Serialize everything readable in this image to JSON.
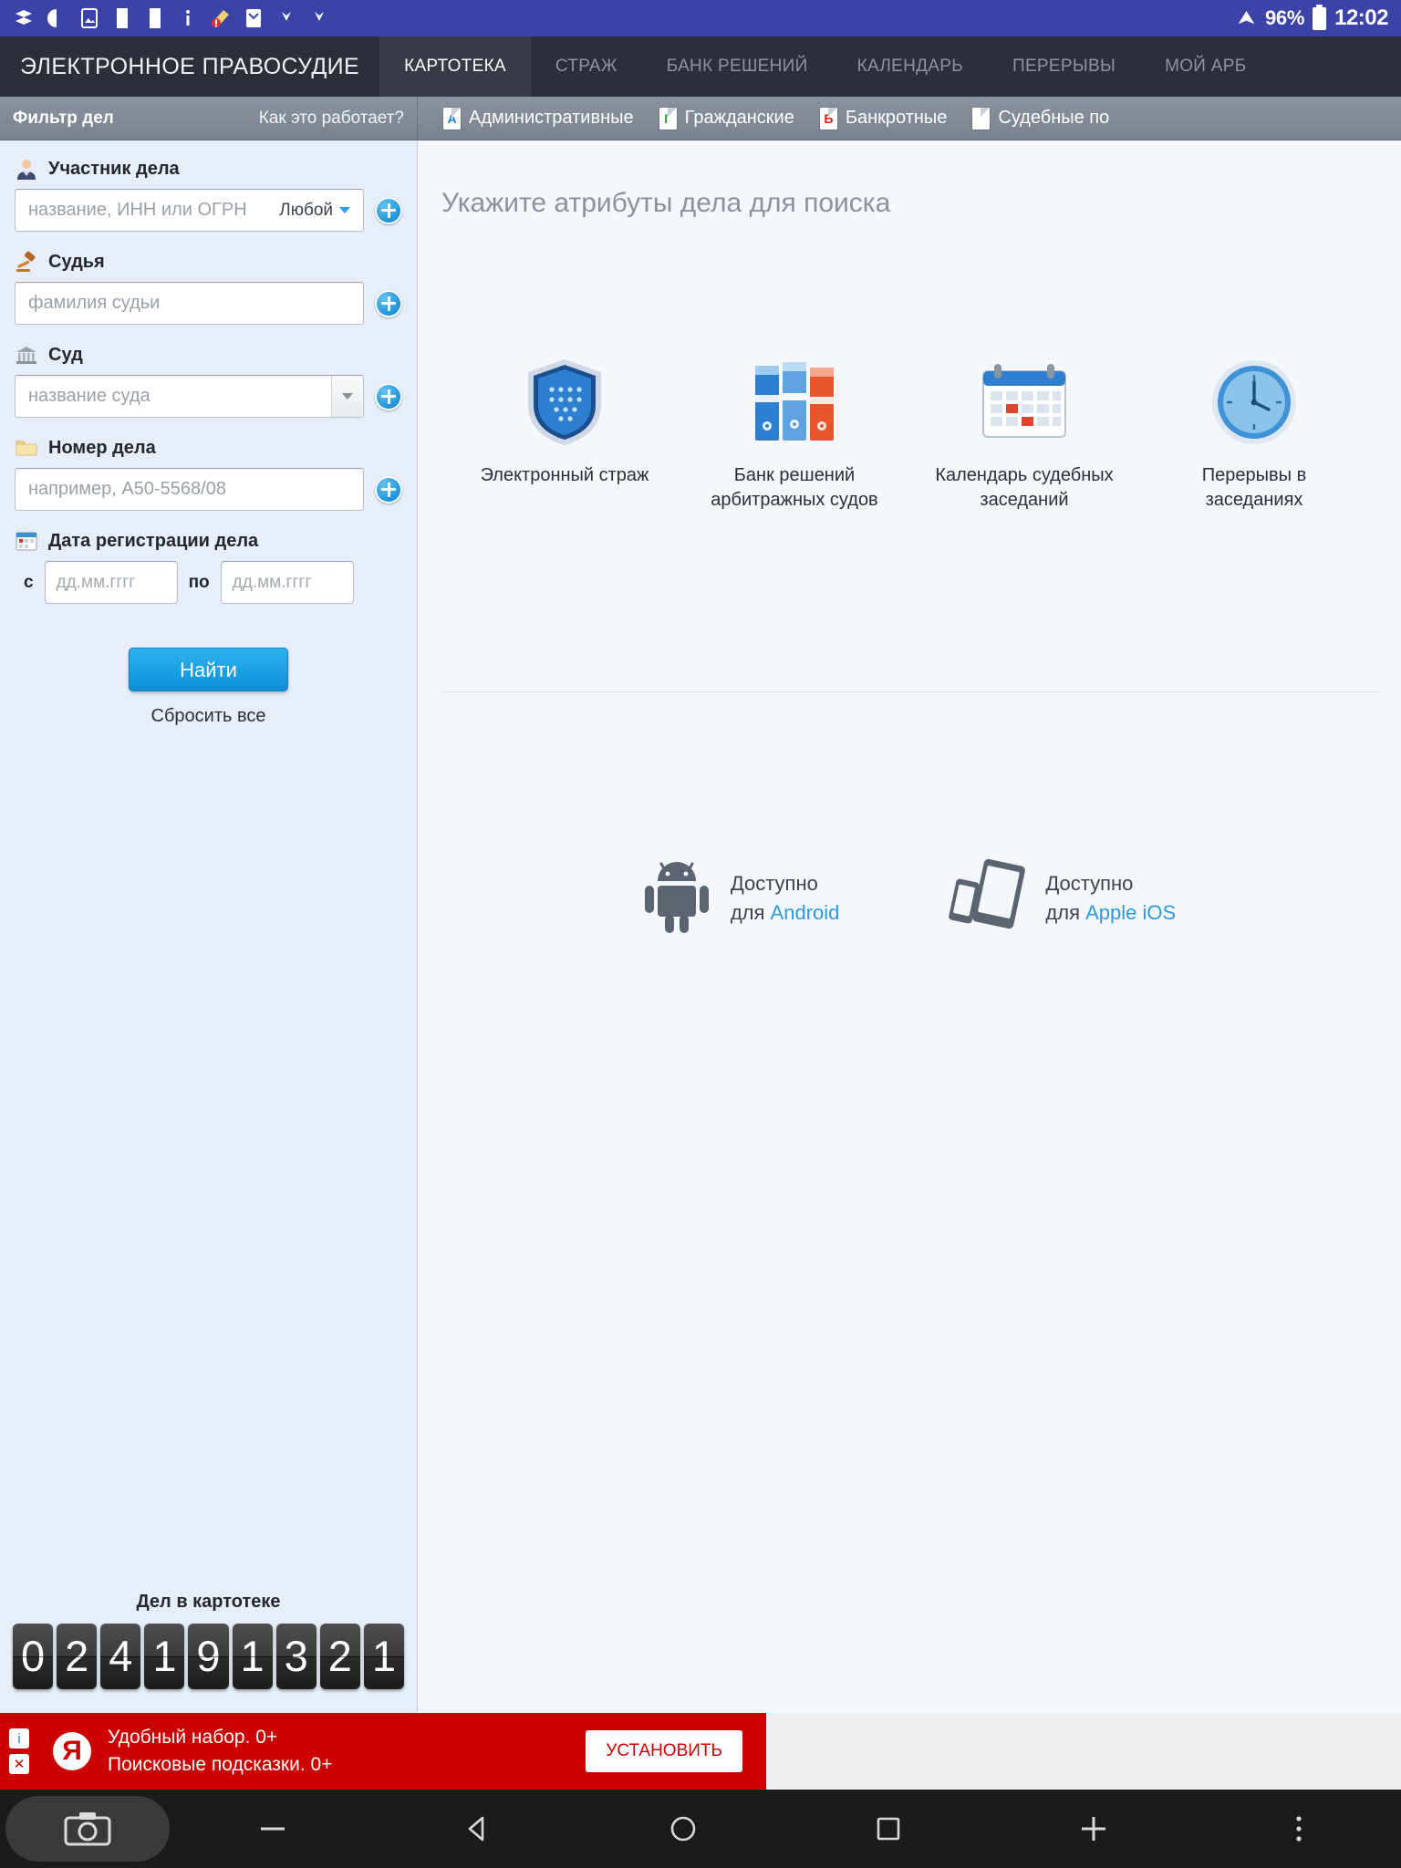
{
  "status_bar": {
    "icons": [
      "stack-icon",
      "navigation-arrow-icon",
      "photo-icon",
      "blank-doc-icon",
      "blank-doc2-icon",
      "info-icon",
      "cleanup-alert-icon",
      "gmail-icon",
      "chevron-down-icon",
      "chevron-down2-icon"
    ],
    "wifi_icon": "wifi-icon",
    "battery_percent": "96%",
    "battery_icon": "battery-icon",
    "time": "12:02"
  },
  "header": {
    "brand": "ЭЛЕКТРОННОЕ ПРАВОСУДИЕ",
    "tabs": [
      {
        "label": "КАРТОТЕКА",
        "active": true
      },
      {
        "label": "СТРАЖ",
        "active": false
      },
      {
        "label": "БАНК РЕШЕНИЙ",
        "active": false
      },
      {
        "label": "КАЛЕНДАРЬ",
        "active": false
      },
      {
        "label": "ПЕРЕРЫВЫ",
        "active": false
      },
      {
        "label": "МОЙ АРБ",
        "active": false
      }
    ]
  },
  "subbar": {
    "filter_title": "Фильтр дел",
    "help_link": "Как это работает?",
    "categories": [
      {
        "label": "Административные",
        "letter": "А",
        "color": "#1f7fd0"
      },
      {
        "label": "Гражданские",
        "letter": "Г",
        "color": "#2aa63c"
      },
      {
        "label": "Банкротные",
        "letter": "Б",
        "color": "#cc2222"
      },
      {
        "label": "Судебные по",
        "letter": "",
        "color": "#9aa3ad"
      }
    ]
  },
  "sidebar": {
    "fields": [
      {
        "id": "participant",
        "icon": "person-icon",
        "label": "Участник дела",
        "placeholder": "название, ИНН или ОГРН",
        "value": "",
        "select_value": "Любой",
        "has_add": true
      },
      {
        "id": "judge",
        "icon": "gavel-icon",
        "label": "Судья",
        "placeholder": "фамилия судьи",
        "value": "",
        "has_add": true
      },
      {
        "id": "court",
        "icon": "courthouse-icon",
        "label": "Суд",
        "placeholder": "название суда",
        "value": "",
        "has_dropdown": true,
        "has_add": true
      },
      {
        "id": "case-number",
        "icon": "folder-icon",
        "label": "Номер дела",
        "placeholder": "например, А50-5568/08",
        "value": "",
        "has_add": true
      }
    ],
    "date_section": {
      "icon": "calendar-icon",
      "label": "Дата регистрации дела",
      "from_label": "с",
      "from_placeholder": "дд.мм.гггг",
      "from_value": "",
      "to_label": "по",
      "to_placeholder": "дд.мм.гггг",
      "to_value": ""
    },
    "search_button": "Найти",
    "reset_link": "Сбросить все",
    "counter": {
      "title": "Дел в картотеке",
      "digits": [
        "0",
        "2",
        "4",
        "1",
        "9",
        "1",
        "3",
        "2",
        "1"
      ]
    }
  },
  "main": {
    "title": "Укажите атрибуты дела для поиска",
    "promos": [
      {
        "icon": "shield-icon",
        "label": "Электронный страж"
      },
      {
        "icon": "binders-icon",
        "label": "Банк решений арбитражных судов"
      },
      {
        "icon": "calendar-big-icon",
        "label": "Календарь судебных заседаний"
      },
      {
        "icon": "clock-icon",
        "label": "Перерывы в заседаниях"
      }
    ],
    "apps": [
      {
        "icon": "android-icon",
        "line1": "Доступно",
        "line2_prefix": "для ",
        "link": "Android"
      },
      {
        "icon": "apple-devices-icon",
        "line1": "Доступно",
        "line2_prefix": "для ",
        "link": "Apple iOS"
      }
    ]
  },
  "ad": {
    "brand_icon": "yandex-icon",
    "info_badge": "i",
    "close_badge": "✕",
    "line1": "Удобный набор. 0+",
    "line2": "Поисковые подсказки. 0+",
    "button": "УСТАНОВИТЬ"
  },
  "navbar": {
    "buttons": [
      "camera-icon",
      "minus-icon",
      "back-triangle-icon",
      "home-circle-icon",
      "recents-square-icon",
      "plus-icon",
      "overflow-menu-icon"
    ]
  },
  "colors": {
    "status_bar": "#3b43a8",
    "app_bar": "#2b2f3a",
    "accent_blue": "#2f9ae0",
    "sidebar_bg": "#e7eefa",
    "ad_red": "#cc0000"
  }
}
